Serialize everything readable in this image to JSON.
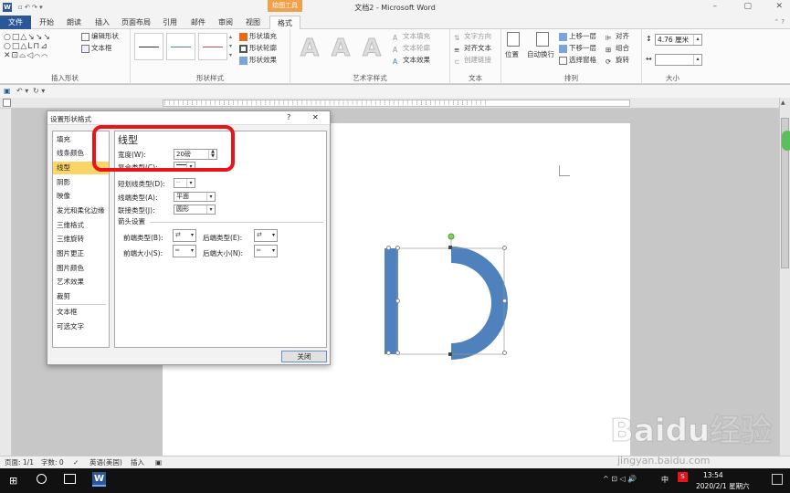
{
  "app": {
    "title": "文档2 - Microsoft Word",
    "context_group": "绘图工具",
    "tabs": [
      "文件",
      "开始",
      "朗读",
      "插入",
      "页面布局",
      "引用",
      "邮件",
      "审阅",
      "视图",
      "格式"
    ]
  },
  "ribbon": {
    "insert_shapes": {
      "label": "插入形状",
      "edit_shape": "编辑形状",
      "text_box": "文本框"
    },
    "shape_styles": {
      "label": "形状样式",
      "fill": "形状填充",
      "outline": "形状轮廓",
      "effects": "形状效果"
    },
    "wordart": {
      "label": "艺术字样式",
      "text_fill": "文本填充",
      "text_outline": "文本轮廓",
      "text_effects": "文本效果",
      "sample": "A"
    },
    "text": {
      "label": "文本",
      "direction": "文字方向",
      "align": "对齐文本",
      "link": "创建链接"
    },
    "arrange": {
      "label": "排列",
      "position": "位置",
      "wrap": "自动换行",
      "bring_forward": "上移一层",
      "send_backward": "下移一层",
      "selection_pane": "选择窗格",
      "align": "对齐",
      "group": "组合",
      "rotate": "旋转"
    },
    "size": {
      "label": "大小",
      "height": "4.76 厘米",
      "width": ""
    }
  },
  "colors": {
    "shape": "#4f81bd",
    "selected_cat": "#fbd568",
    "highlight": "#e8131b",
    "file_tab": "#2b5797",
    "context": "#f0a24a"
  },
  "dialog": {
    "title": "设置形状格式",
    "help": "?",
    "close_x": "✕",
    "categories": [
      "填充",
      "线条颜色",
      "线型",
      "阴影",
      "映像",
      "发光和柔化边缘",
      "三维格式",
      "三维旋转",
      "图片更正",
      "图片颜色",
      "艺术效果",
      "裁剪",
      "文本框",
      "可选文字"
    ],
    "selected_category": "线型",
    "panel": {
      "heading": "线型",
      "width_label": "宽度(W):",
      "width_value": "20磅",
      "compound_label": "复合类型(C):",
      "dash_label": "短划线类型(D):",
      "cap_label": "线端类型(A):",
      "cap_value": "平面",
      "join_label": "联接类型(J):",
      "join_value": "圆形",
      "arrow_section": "箭头设置",
      "begin_type": "前端类型(B):",
      "end_type": "后端类型(E):",
      "begin_size": "前端大小(S):",
      "end_size": "后端大小(N):"
    },
    "close_button": "关闭"
  },
  "status": {
    "page": "页面: 1/1",
    "words": "字数: 0",
    "language": "英语(美国)",
    "mode": "插入"
  },
  "taskbar": {
    "time": "13:54",
    "date": "2020/2/1 星期六",
    "ime": "中"
  },
  "watermark": {
    "brand": "Baidu经验",
    "url": "jingyan.baidu.com"
  }
}
